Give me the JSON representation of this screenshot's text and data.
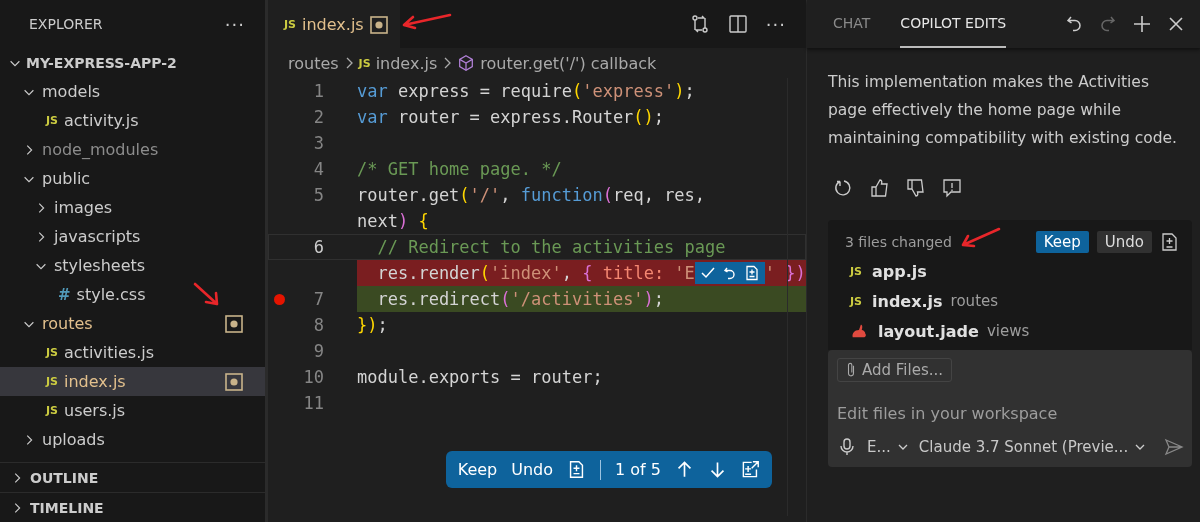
{
  "sidebar": {
    "title": "EXPLORER",
    "more": "···",
    "root": {
      "label": "MY-EXPRESS-APP-2",
      "expanded": true
    },
    "tree": [
      {
        "label": "models",
        "kind": "folder",
        "expanded": true,
        "selected": false,
        "modified": false,
        "ignored": false,
        "children": [
          {
            "label": "activity.js",
            "kind": "file",
            "icon_text": "JS",
            "selected": false,
            "modified": false,
            "ignored": false
          }
        ]
      },
      {
        "label": "node_modules",
        "kind": "folder",
        "expanded": false,
        "selected": false,
        "modified": false,
        "ignored": true
      },
      {
        "label": "public",
        "kind": "folder",
        "expanded": true,
        "selected": false,
        "modified": false,
        "ignored": false,
        "children": [
          {
            "label": "images",
            "kind": "folder",
            "expanded": false,
            "selected": false,
            "modified": false,
            "ignored": false
          },
          {
            "label": "javascripts",
            "kind": "folder",
            "expanded": false,
            "selected": false,
            "modified": false,
            "ignored": false
          },
          {
            "label": "stylesheets",
            "kind": "folder",
            "expanded": true,
            "selected": false,
            "modified": false,
            "ignored": false,
            "children": [
              {
                "label": "style.css",
                "kind": "file",
                "icon_text": "#",
                "selected": false,
                "modified": false,
                "ignored": false
              }
            ]
          }
        ]
      },
      {
        "label": "routes",
        "kind": "folder",
        "expanded": true,
        "selected": false,
        "modified": true,
        "ignored": false,
        "children": [
          {
            "label": "activities.js",
            "kind": "file",
            "icon_text": "JS",
            "selected": false,
            "modified": false,
            "ignored": false
          },
          {
            "label": "index.js",
            "kind": "file",
            "icon_text": "JS",
            "selected": true,
            "modified": true,
            "ignored": false
          },
          {
            "label": "users.js",
            "kind": "file",
            "icon_text": "JS",
            "selected": false,
            "modified": false,
            "ignored": false
          }
        ]
      },
      {
        "label": "uploads",
        "kind": "folder",
        "expanded": false,
        "selected": false,
        "modified": false,
        "ignored": false
      }
    ],
    "sections": [
      {
        "label": "OUTLINE",
        "expanded": false
      },
      {
        "label": "TIMELINE",
        "expanded": false
      }
    ]
  },
  "editor": {
    "tab": {
      "icon_text": "JS",
      "label": "index.js",
      "modified": true
    },
    "more": "···",
    "breadcrumb": {
      "folder": "routes",
      "file_icon_text": "JS",
      "file": "index.js",
      "symbol": "router.get('/') callback"
    },
    "rows": [
      {
        "number": "1",
        "current": false,
        "breakpoint": false,
        "kind": "code",
        "tokens": [
          {
            "kind": "kw",
            "text": "var"
          },
          {
            "kind": "txt",
            "text": " express = require"
          },
          {
            "kind": "brk",
            "text": "("
          },
          {
            "kind": "str",
            "text": "'express'"
          },
          {
            "kind": "brk",
            "text": ")"
          },
          {
            "kind": "txt",
            "text": ";"
          }
        ]
      },
      {
        "number": "2",
        "current": false,
        "breakpoint": false,
        "kind": "code",
        "tokens": [
          {
            "kind": "kw",
            "text": "var"
          },
          {
            "kind": "txt",
            "text": " router = express.Router"
          },
          {
            "kind": "brk",
            "text": "()"
          },
          {
            "kind": "txt",
            "text": ";"
          }
        ]
      },
      {
        "number": "3",
        "current": false,
        "breakpoint": false,
        "kind": "code"
      },
      {
        "number": "4",
        "current": false,
        "breakpoint": false,
        "kind": "code",
        "tokens": [
          {
            "kind": "com",
            "text": "/* GET home page. */"
          }
        ]
      },
      {
        "number": "5",
        "current": false,
        "breakpoint": false,
        "kind": "code",
        "tokens": [
          {
            "kind": "txt",
            "text": "router.get"
          },
          {
            "kind": "brk",
            "text": "("
          },
          {
            "kind": "str",
            "text": "'/'"
          },
          {
            "kind": "txt",
            "text": ", "
          },
          {
            "kind": "kw",
            "text": "function"
          },
          {
            "kind": "brk2",
            "text": "("
          },
          {
            "kind": "txt",
            "text": "req, res,"
          }
        ]
      },
      {
        "current": false,
        "breakpoint": false,
        "kind": "code",
        "tokens": [
          {
            "kind": "txt",
            "text": "next"
          },
          {
            "kind": "brk2",
            "text": ") "
          },
          {
            "kind": "brk",
            "text": "{"
          }
        ]
      },
      {
        "number": "6",
        "current": true,
        "breakpoint": false,
        "kind": "code",
        "tokens": [
          {
            "kind": "com",
            "text": "  // Redirect to the activities page"
          }
        ]
      },
      {
        "current": false,
        "breakpoint": false,
        "kind": "removed",
        "tokens": [
          {
            "kind": "txt",
            "text": "  res.render"
          },
          {
            "kind": "brk",
            "text": "("
          },
          {
            "kind": "str",
            "text": "'index'"
          },
          {
            "kind": "txt",
            "text": ", "
          },
          {
            "kind": "brk2",
            "text": "{"
          },
          {
            "kind": "red",
            "text": " title: "
          },
          {
            "kind": "str",
            "text": "'E"
          }
        ],
        "hunk_toolbar": true,
        "tokens_after": [
          {
            "kind": "str",
            "text": "' "
          },
          {
            "kind": "brk2",
            "text": "})"
          }
        ]
      },
      {
        "number": "7",
        "current": false,
        "breakpoint": true,
        "kind": "added",
        "tokens": [
          {
            "kind": "txt",
            "text": "  res.redirect"
          },
          {
            "kind": "brk2",
            "text": "("
          },
          {
            "kind": "str",
            "text": "'/activities'"
          },
          {
            "kind": "brk2",
            "text": ")"
          },
          {
            "kind": "txt",
            "text": ";"
          }
        ]
      },
      {
        "number": "8",
        "current": false,
        "breakpoint": false,
        "kind": "code",
        "tokens": [
          {
            "kind": "brk",
            "text": "}"
          },
          {
            "kind": "brk",
            "text": ")"
          },
          {
            "kind": "txt",
            "text": ";"
          }
        ]
      },
      {
        "number": "9",
        "current": false,
        "breakpoint": false,
        "kind": "code"
      },
      {
        "number": "10",
        "current": false,
        "breakpoint": false,
        "kind": "code",
        "tokens": [
          {
            "kind": "txt",
            "text": "module.exports = router;"
          }
        ]
      },
      {
        "number": "11",
        "current": false,
        "breakpoint": false,
        "kind": "code"
      }
    ],
    "review_bar": {
      "keep": "Keep",
      "undo": "Undo",
      "position": "1 of 5"
    }
  },
  "panel": {
    "tabs": [
      {
        "label": "CHAT",
        "selected": false
      },
      {
        "label": "COPILOT EDITS",
        "selected": true
      }
    ],
    "redo_disabled": true,
    "message": "This implementation makes the Activities page effectively the home page while maintaining compatibility with existing code.",
    "changes": {
      "summary": "3 files changed",
      "keep": "Keep",
      "undo": "Undo",
      "files": [
        {
          "kind": "js",
          "icon_text": "JS",
          "name": "app.js"
        },
        {
          "kind": "js",
          "icon_text": "JS",
          "name": "index.js",
          "folder": "routes"
        },
        {
          "kind": "jade",
          "name": "layout.jade",
          "folder": "views"
        }
      ]
    },
    "input": {
      "add_files": "Add Files...",
      "placeholder": "Edit files in your workspace",
      "mode": "E...",
      "model": "Claude 3.7 Sonnet (Previe..."
    }
  }
}
